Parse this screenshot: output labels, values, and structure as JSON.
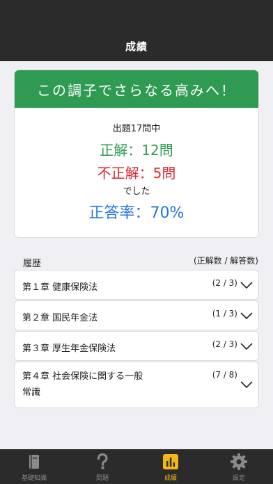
{
  "navbar": {
    "title": "成績"
  },
  "result": {
    "header": "この調子でさらなる高みへ！",
    "question_total": "出題17問中",
    "correct": "正解：12問",
    "incorrect": "不正解：5問",
    "closing": "でした",
    "rate": "正答率：70%"
  },
  "history": {
    "label": "履歴",
    "columns": "(正解数 / 解答数)",
    "chapters": [
      {
        "line1": "第１章 健康保険法",
        "line2": "",
        "score": "(2 / 3)"
      },
      {
        "line1": "第２章 国民年金法",
        "line2": "",
        "score": "(1 / 3)"
      },
      {
        "line1": "第３章 厚生年金保険法",
        "line2": "",
        "score": "(2 / 3)"
      },
      {
        "line1": "第４章 社会保険に関する一般",
        "line2": "常識",
        "score": "(7 / 8)"
      }
    ]
  },
  "tabbar": {
    "items": [
      {
        "label": "基礎知識",
        "icon": "book-icon"
      },
      {
        "label": "問題",
        "icon": "question-icon"
      },
      {
        "label": "成績",
        "icon": "chart-icon"
      },
      {
        "label": "設定",
        "icon": "gear-icon"
      }
    ],
    "active_color": "#f3b816",
    "inactive_color": "#8a8a8a"
  },
  "colors": {
    "header_green": "#2f9a52",
    "correct_green": "#2f9a52",
    "incorrect_red": "#e0282e",
    "rate_blue": "#2277e0"
  }
}
